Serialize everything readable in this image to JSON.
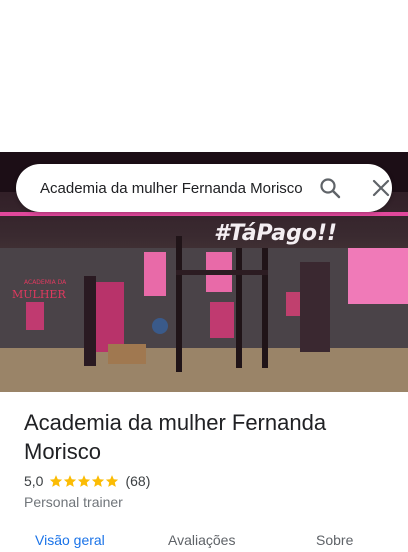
{
  "search": {
    "value": "Academia da mulher Fernanda Morisco"
  },
  "photo": {
    "wall_text_main": "#TáPago!!",
    "sign_text": "MULHER",
    "sign_text_small": "ACADEMIA DA"
  },
  "place": {
    "name": "Academia da mulher Fernanda Morisco",
    "rating": "5,0",
    "stars": 5,
    "reviews": "(68)",
    "category": "Personal trainer"
  },
  "tabs": [
    {
      "label": "Visão geral",
      "active": true
    },
    {
      "label": "Avaliações",
      "active": false
    },
    {
      "label": "Sobre",
      "active": false
    }
  ],
  "colors": {
    "accent": "#1a73e8",
    "star": "#fbbc04",
    "neon": "#ff4fb0"
  },
  "icons": {
    "search": "search-icon",
    "close": "close-icon",
    "star": "star-icon"
  }
}
